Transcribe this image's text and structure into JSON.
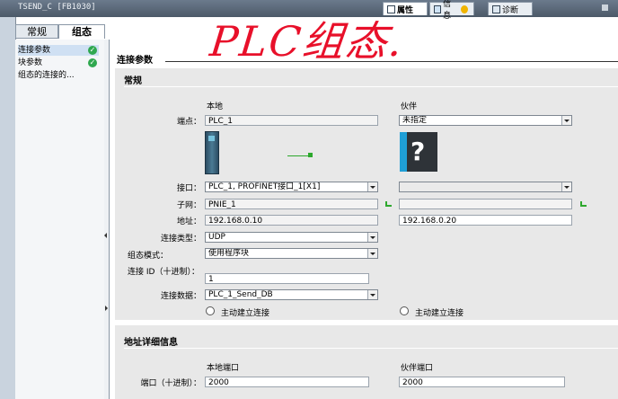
{
  "window": {
    "title": "TSEND_C [FB1030]"
  },
  "inspector_tabs": [
    {
      "label": "属性",
      "active": true
    },
    {
      "label": "信息",
      "active": false
    },
    {
      "label": "诊断",
      "active": false
    }
  ],
  "nav": {
    "tabs": [
      {
        "label": "常规"
      },
      {
        "label": "组态"
      }
    ],
    "items": [
      {
        "label": "连接参数",
        "status": "ok"
      },
      {
        "label": "块参数",
        "status": "ok"
      },
      {
        "label": "组态的连接的...",
        "status": ""
      }
    ]
  },
  "annotation": {
    "text": "PLC组态."
  },
  "connection_params": {
    "section_title": "连接参数",
    "subsection_title": "常规",
    "local_header": "本地",
    "partner_header": "伙伴",
    "endpoint_label": "端点：",
    "local_endpoint": "PLC_1",
    "partner_endpoint": "未指定",
    "interface_label": "接口：",
    "local_interface": "PLC_1, PROFINET接口_1[X1]",
    "partner_interface": "",
    "subnet_label": "子网：",
    "local_subnet": "PNIE_1",
    "partner_subnet": "",
    "address_label": "地址：",
    "local_address": "192.168.0.10",
    "partner_address": "192.168.0.20",
    "conn_type_label": "连接类型：",
    "conn_type": "UDP",
    "config_mode_label": "组态模式：",
    "config_mode": "使用程序块",
    "conn_id_label": "连接 ID（十进制）：",
    "conn_id": "1",
    "conn_data_label": "连接数据：",
    "conn_data": "PLC_1_Send_DB",
    "local_active_label": "主动建立连接",
    "partner_active_label": "主动建立连接"
  },
  "address_details": {
    "title": "地址详细信息",
    "local_port_header": "本地端口",
    "partner_port_header": "伙伴端口",
    "port_label": "端口（十进制）：",
    "local_port": "2000",
    "partner_port": "2000"
  },
  "colors": {
    "annotation": "#e8102a",
    "ok_green": "#2fa84f",
    "title_bar": "#5a6878"
  }
}
